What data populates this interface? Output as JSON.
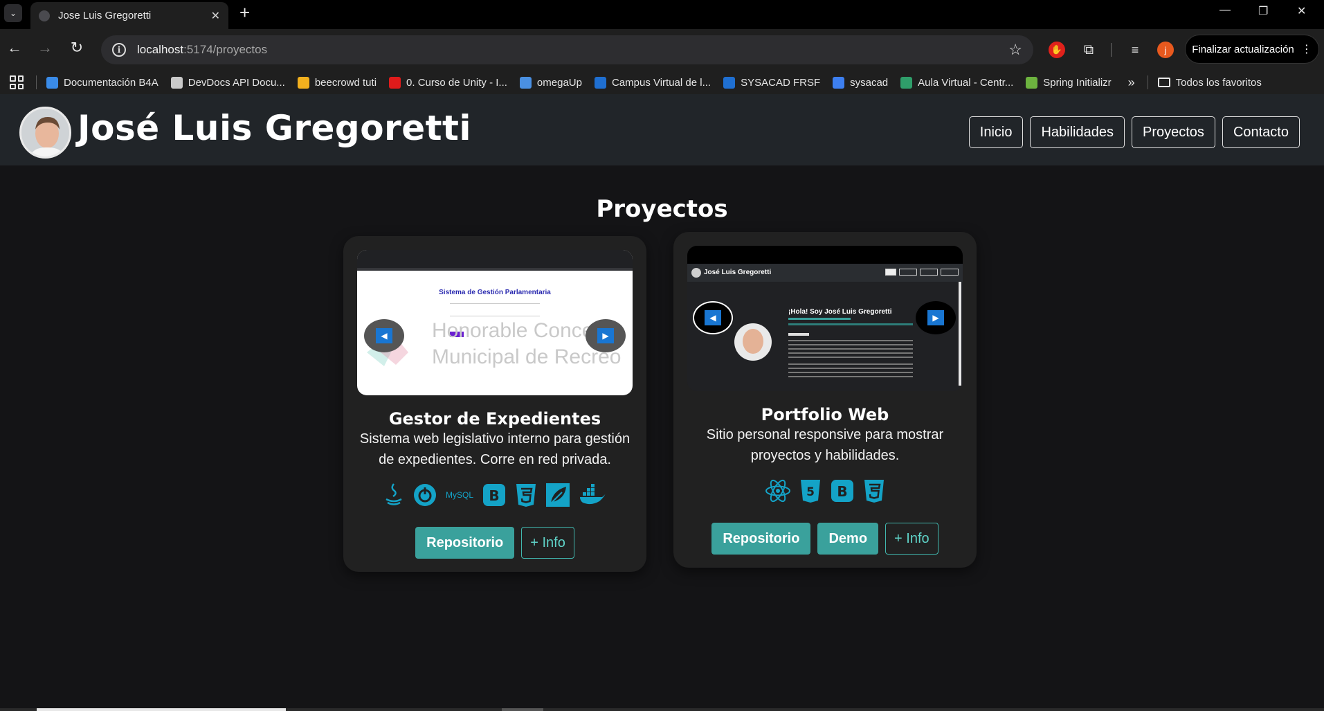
{
  "browser": {
    "tab_title": "Jose Luis Gregoretti",
    "url_host": "localhost",
    "url_path": ":5174/proyectos",
    "update_button": "Finalizar actualización",
    "profile_initial": "j",
    "bookmarks": [
      {
        "label": "Documentación B4A",
        "color": "#3a8be8"
      },
      {
        "label": "DevDocs API Docu...",
        "color": "#c9c9c9"
      },
      {
        "label": "beecrowd tuti",
        "color": "#f2b01e"
      },
      {
        "label": "0. Curso de Unity - I...",
        "color": "#e01b1b"
      },
      {
        "label": "omegaUp",
        "color": "#4a90e2"
      },
      {
        "label": "Campus Virtual de l...",
        "color": "#1f6fd1"
      },
      {
        "label": "SYSACAD FRSF",
        "color": "#1f6fd1"
      },
      {
        "label": "sysacad",
        "color": "#3d7ff0"
      },
      {
        "label": "Aula Virtual - Centr...",
        "color": "#2f9e6a"
      },
      {
        "label": "Spring Initializr",
        "color": "#6db33f"
      }
    ],
    "all_bookmarks": "Todos los favoritos"
  },
  "site": {
    "name": "José Luis Gregoretti",
    "nav": [
      "Inicio",
      "Habilidades",
      "Proyectos",
      "Contacto"
    ]
  },
  "section_title": "Proyectos",
  "projects": [
    {
      "title": "Gestor de Expedientes",
      "description": "Sistema web legislativo interno para gestión de expedientes. Corre en red privada.",
      "preview_heading": "Sistema de Gestión Parlamentaria",
      "preview_watermark_1": "Honorable Concejo",
      "preview_watermark_2": "Municipal de Recreo",
      "techs": [
        "java-icon",
        "spring-boot-icon",
        "mysql-icon",
        "bootstrap-icon",
        "css3-icon",
        "spring-icon",
        "docker-icon"
      ],
      "buttons": {
        "repo": "Repositorio",
        "info": "+ Info"
      }
    },
    {
      "title": "Portfolio Web",
      "description": "Sitio personal responsive para mostrar proyectos y habilidades.",
      "preview_heading": "¡Hola! Soy José Luis Gregoretti",
      "preview_name": "José Luis Gregoretti",
      "techs": [
        "react-icon",
        "html5-icon",
        "bootstrap-icon",
        "css3-icon"
      ],
      "buttons": {
        "repo": "Repositorio",
        "demo": "Demo",
        "info": "+ Info"
      }
    }
  ],
  "colors": {
    "accent": "#3aa19c",
    "tech_icon": "#14a3c7",
    "header_bg": "#212529",
    "page_bg": "#141416"
  }
}
